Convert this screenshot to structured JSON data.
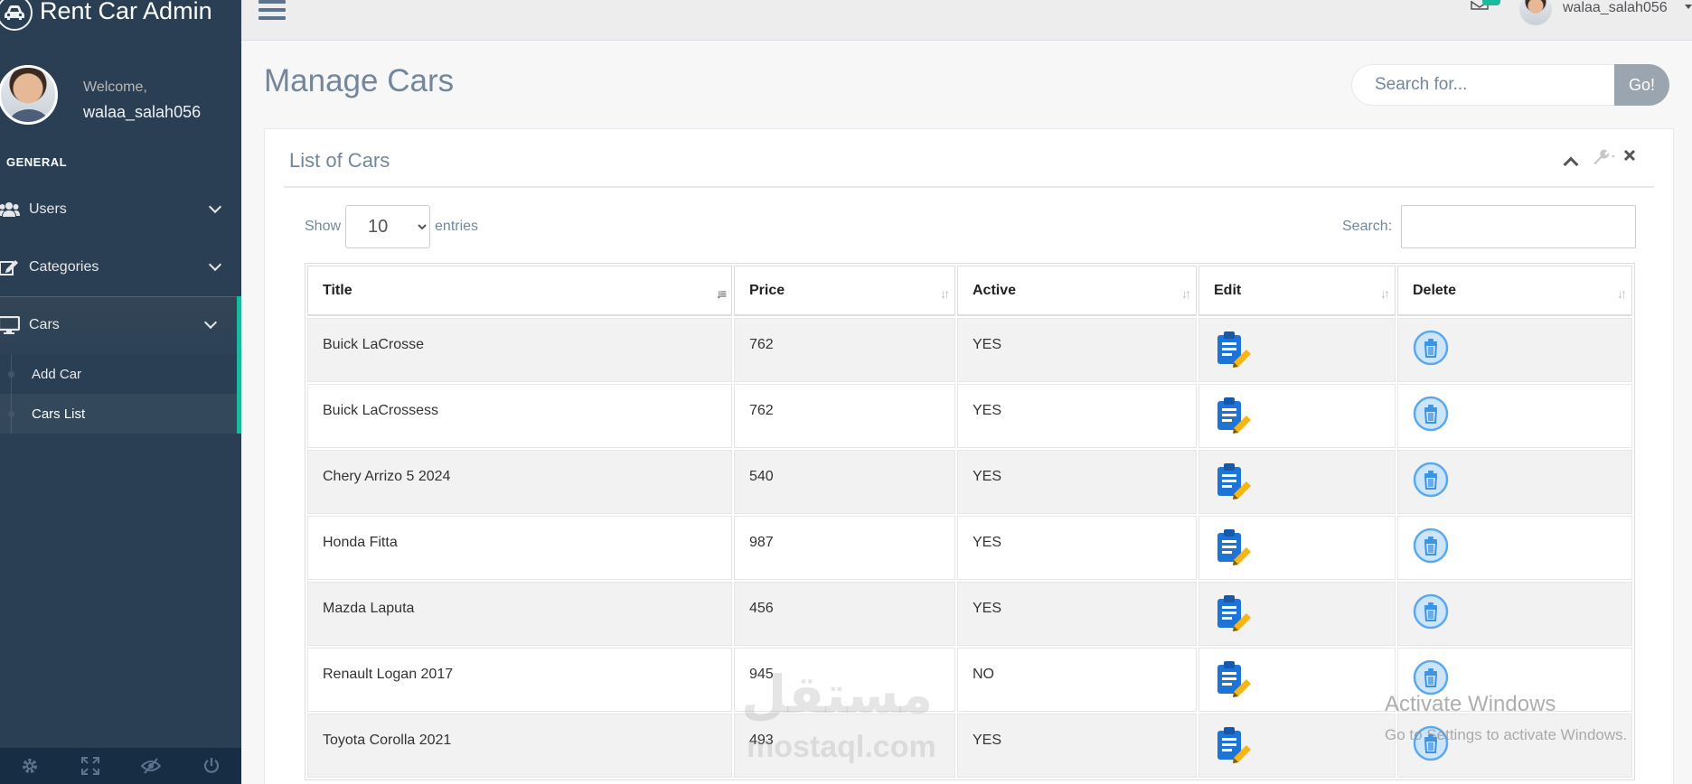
{
  "app": {
    "title": "Rent Car Admin"
  },
  "profile": {
    "welcome": "Welcome,",
    "username": "walaa_salah056"
  },
  "sidebar": {
    "section": "GENERAL",
    "items": [
      {
        "label": "Users",
        "icon": "users-icon"
      },
      {
        "label": "Categories",
        "icon": "edit-icon"
      },
      {
        "label": "Cars",
        "icon": "desktop-icon"
      }
    ],
    "submenu": [
      {
        "label": "Add Car"
      },
      {
        "label": "Cars List"
      }
    ]
  },
  "topnav": {
    "username": "walaa_salah056"
  },
  "page": {
    "title": "Manage Cars"
  },
  "search": {
    "placeholder": "Search for...",
    "button": "Go!"
  },
  "panel": {
    "title": "List of Cars"
  },
  "table_controls": {
    "show_label": "Show",
    "entries_label": "entries",
    "page_size": "10",
    "search_label": "Search:"
  },
  "table": {
    "headers": [
      "Title",
      "Price",
      "Active",
      "Edit",
      "Delete"
    ],
    "rows": [
      {
        "title": "Buick LaCrosse",
        "price": "762",
        "active": "YES"
      },
      {
        "title": "Buick LaCrossess",
        "price": "762",
        "active": "YES"
      },
      {
        "title": "Chery Arrizo 5 2024",
        "price": "540",
        "active": "YES"
      },
      {
        "title": "Honda Fitta",
        "price": "987",
        "active": "YES"
      },
      {
        "title": "Mazda Laputa",
        "price": "456",
        "active": "YES"
      },
      {
        "title": "Renault Logan 2017",
        "price": "945",
        "active": "NO"
      },
      {
        "title": "Toyota Corolla 2021",
        "price": "493",
        "active": "YES"
      }
    ]
  },
  "watermark": {
    "arabic": "مستقل",
    "latin": "mostaql.com"
  },
  "windows_notice": {
    "line1": "Activate Windows",
    "line2": "Go to Settings to activate Windows."
  },
  "colors": {
    "sidebar": "#2A3F54",
    "accent": "#1ABB9C",
    "text": "#73879C"
  }
}
